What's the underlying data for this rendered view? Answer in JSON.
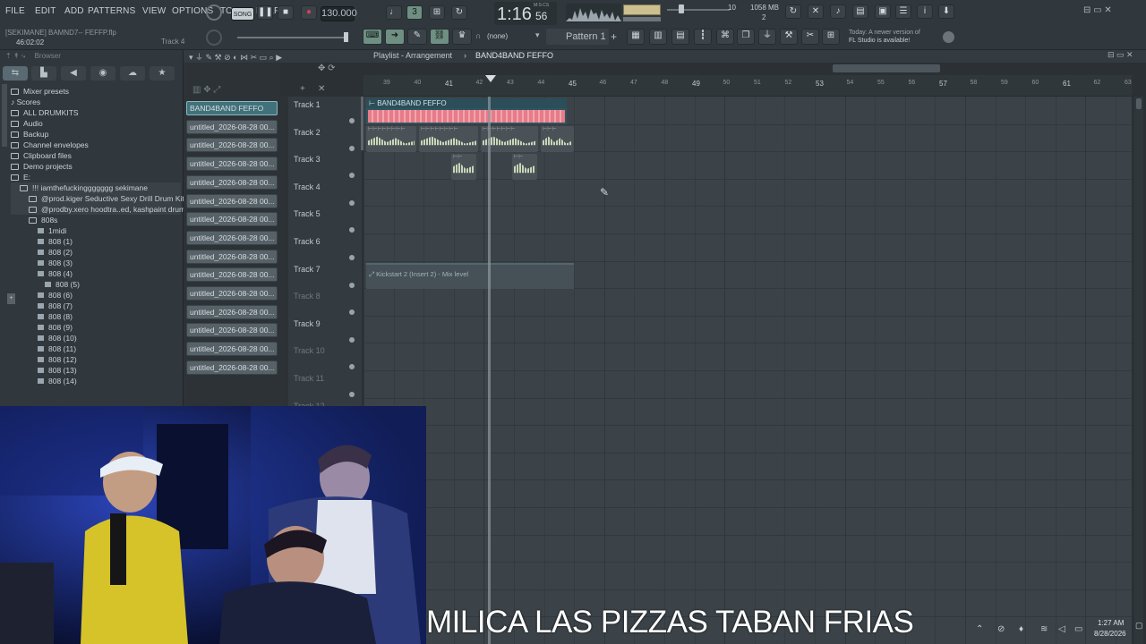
{
  "menu": [
    "FILE",
    "EDIT",
    "ADD",
    "PATTERNS",
    "VIEW",
    "OPTIONS",
    "TOOLS",
    "HELP"
  ],
  "transport": {
    "mode": "SONG",
    "tempo": "130.000",
    "time": "1:16",
    "time_small": "56",
    "time_unit": "M:S:CS"
  },
  "stats": {
    "mem": "1058 MB",
    "cpu": "2",
    "counter": "10"
  },
  "project": {
    "name": "[SEKIMANE] BAMND7-- FEFFP.flp",
    "time": "46:02:02",
    "track_hint": "Track 4"
  },
  "snap": {
    "value": "(none)"
  },
  "pattern": {
    "label": "Pattern 1"
  },
  "news": {
    "line1": "Today: A newer version of",
    "line2": "FL Studio is available!"
  },
  "playlist": {
    "title": "Playlist - Arrangement",
    "arrangement": "BAND4BAND FEFFO"
  },
  "browser": {
    "title": "Browser",
    "items": [
      {
        "label": "Mixer presets",
        "icon": "folder"
      },
      {
        "label": "Scores",
        "icon": "note"
      },
      {
        "label": "ALL DRUMKITS",
        "icon": "folder"
      },
      {
        "label": "Audio",
        "icon": "folder"
      },
      {
        "label": "Backup",
        "icon": "folder"
      },
      {
        "label": "Channel envelopes",
        "icon": "folder"
      },
      {
        "label": "Clipboard files",
        "icon": "folder"
      },
      {
        "label": "Demo projects",
        "icon": "folder"
      },
      {
        "label": "E:",
        "icon": "folder"
      },
      {
        "label": "!!! iamthefuckinggggggg sekimane",
        "icon": "folder"
      },
      {
        "label": "@prod.kiger Seductive Sexy Drill Drum Kit",
        "icon": "folder"
      },
      {
        "label": "@prodby.xero hoodtra..ed, kashpaint drum kit",
        "icon": "folder"
      },
      {
        "label": "808s",
        "icon": "folder"
      },
      {
        "label": "1midi",
        "icon": "file"
      },
      {
        "label": "808 (1)",
        "icon": "file"
      },
      {
        "label": "808 (2)",
        "icon": "file"
      },
      {
        "label": "808 (3)",
        "icon": "file"
      },
      {
        "label": "808 (4)",
        "icon": "file"
      },
      {
        "label": "808 (5)",
        "icon": "file"
      },
      {
        "label": "808 (6)",
        "icon": "file"
      },
      {
        "label": "808 (7)",
        "icon": "file"
      },
      {
        "label": "808 (8)",
        "icon": "file"
      },
      {
        "label": "808 (9)",
        "icon": "file"
      },
      {
        "label": "808 (10)",
        "icon": "file"
      },
      {
        "label": "808 (11)",
        "icon": "file"
      },
      {
        "label": "808 (12)",
        "icon": "file"
      },
      {
        "label": "808 (13)",
        "icon": "file"
      },
      {
        "label": "808 (14)",
        "icon": "file"
      }
    ]
  },
  "patterns": [
    "BAND4BAND FEFFO",
    "untitled_2026-08-28 00...",
    "untitled_2026-08-28 00...",
    "untitled_2026-08-28 00...",
    "untitled_2026-08-28 00...",
    "untitled_2026-08-28 00...",
    "untitled_2026-08-28 00...",
    "untitled_2026-08-28 00...",
    "untitled_2026-08-28 00...",
    "untitled_2026-08-28 00...",
    "untitled_2026-08-28 00...",
    "untitled_2026-08-28 00...",
    "untitled_2026-08-28 00...",
    "untitled_2026-08-28 00...",
    "untitled_2026-08-28 00..."
  ],
  "tracks": [
    "Track 1",
    "Track 2",
    "Track 3",
    "Track 4",
    "Track 5",
    "Track 6",
    "Track 7",
    "Track 8",
    "Track 9",
    "Track 10",
    "Track 11",
    "Track 12"
  ],
  "ruler": [
    "39",
    "40",
    "41",
    "42",
    "43",
    "44",
    "45",
    "46",
    "47",
    "48",
    "49",
    "50",
    "51",
    "52",
    "53",
    "54",
    "55",
    "56",
    "57",
    "58",
    "59",
    "60",
    "61",
    "62",
    "63"
  ],
  "clips": {
    "track1": "BAND4BAND FEFFO",
    "track7": "Kickstart 2 (Insert 2) - Mix level"
  },
  "caption": "MILICA LAS PIZZAS TABAN FRIAS",
  "clock": {
    "time": "1:27 AM",
    "date": "8/28/2026"
  }
}
